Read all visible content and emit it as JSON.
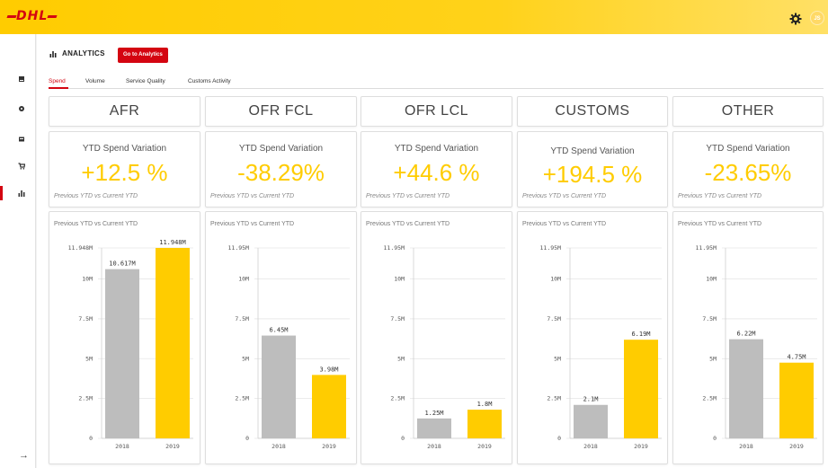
{
  "header": {
    "logo": "DHL"
  },
  "user": {
    "initials": "JS"
  },
  "section": {
    "title": "ANALYTICS",
    "goto_label": "Go to Analytics"
  },
  "tabs": [
    {
      "label": "Spend",
      "active": true
    },
    {
      "label": "Volume",
      "active": false
    },
    {
      "label": "Service Quality",
      "active": false
    },
    {
      "label": "Customs Activity",
      "active": false
    }
  ],
  "colors": {
    "brand_yellow": "#ffcc00",
    "brand_red": "#d40511",
    "bar_prev": "#bdbdbd",
    "bar_curr": "#ffcc00"
  },
  "kpi_title": "YTD Spend Variation",
  "kpi_subtitle": "Previous YTD vs Current YTD",
  "chart_subtitle": "Previous YTD vs Current YTD",
  "cards": [
    {
      "category": "AFR",
      "variation": "+12.5 %"
    },
    {
      "category": "OFR FCL",
      "variation": "-38.29%"
    },
    {
      "category": "OFR LCL",
      "variation": "+44.6 %"
    },
    {
      "category": "CUSTOMS",
      "variation": "+194.5 %"
    },
    {
      "category": "OTHER",
      "variation": "-23.65%"
    }
  ],
  "chart_data": [
    {
      "type": "bar",
      "categories": [
        "2018",
        "2019"
      ],
      "values": [
        10.617,
        11.948
      ],
      "data_labels": [
        "10.617M",
        "11.948M"
      ],
      "yticks": [
        "0",
        "2.5M",
        "5M",
        "7.5M",
        "10M",
        "11.948M"
      ],
      "ylim": [
        0,
        11.948
      ]
    },
    {
      "type": "bar",
      "categories": [
        "2018",
        "2019"
      ],
      "values": [
        6.45,
        3.98
      ],
      "data_labels": [
        "6.45M",
        "3.98M"
      ],
      "yticks": [
        "0",
        "2.5M",
        "5M",
        "7.5M",
        "10M",
        "11.95M"
      ],
      "ylim": [
        0,
        11.95
      ]
    },
    {
      "type": "bar",
      "categories": [
        "2018",
        "2019"
      ],
      "values": [
        1.25,
        1.8
      ],
      "data_labels": [
        "1.25M",
        "1.8M"
      ],
      "yticks": [
        "0",
        "2.5M",
        "5M",
        "7.5M",
        "10M",
        "11.95M"
      ],
      "ylim": [
        0,
        11.95
      ]
    },
    {
      "type": "bar",
      "categories": [
        "2018",
        "2019"
      ],
      "values": [
        2.1,
        6.19
      ],
      "data_labels": [
        "2.1M",
        "6.19M"
      ],
      "yticks": [
        "0",
        "2.5M",
        "5M",
        "7.5M",
        "10M",
        "11.95M"
      ],
      "ylim": [
        0,
        11.95
      ]
    },
    {
      "type": "bar",
      "categories": [
        "2018",
        "2019"
      ],
      "values": [
        6.22,
        4.75
      ],
      "data_labels": [
        "6.22M",
        "4.75M"
      ],
      "yticks": [
        "0",
        "2.5M",
        "5M",
        "7.5M",
        "10M",
        "11.95M"
      ],
      "ylim": [
        0,
        11.95
      ]
    }
  ]
}
